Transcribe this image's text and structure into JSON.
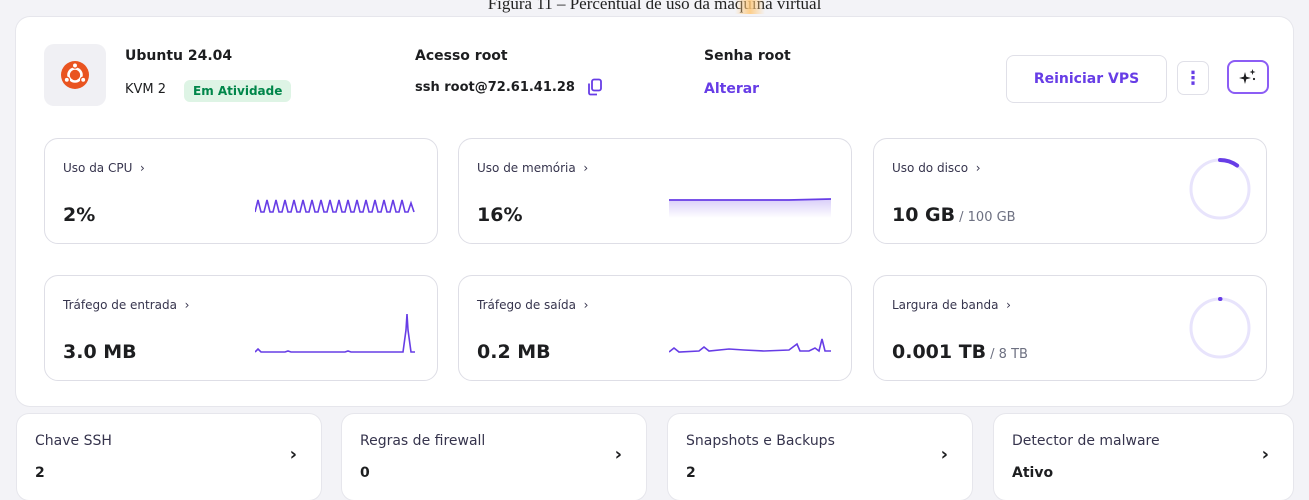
{
  "caption": {
    "text": "Figura 11 – Percentual de uso da máquina virtual"
  },
  "server": {
    "os": "Ubuntu 24.04",
    "plan": "KVM 2",
    "status": "Em Atividade"
  },
  "access": {
    "label": "Acesso root",
    "command": "ssh root@72.61.41.28"
  },
  "password": {
    "label": "Senha root",
    "action": "Alterar"
  },
  "actions": {
    "restart": "Reiniciar VPS",
    "more": "⋮"
  },
  "metrics": [
    {
      "label": "Uso da CPU",
      "value": "2%",
      "total": ""
    },
    {
      "label": "Uso de memória",
      "value": "16%",
      "total": ""
    },
    {
      "label": "Uso do disco",
      "value": "10 GB",
      "total": "/ 100 GB",
      "progress": 0.1
    },
    {
      "label": "Tráfego de entrada",
      "value": "3.0 MB",
      "total": ""
    },
    {
      "label": "Tráfego de saída",
      "value": "0.2 MB",
      "total": ""
    },
    {
      "label": "Largura de banda",
      "value": "0.001 TB",
      "total": "/ 8 TB",
      "progress": 0.0001
    }
  ],
  "quick_links": [
    {
      "label": "Chave SSH",
      "value": "2"
    },
    {
      "label": "Regras de firewall",
      "value": "0"
    },
    {
      "label": "Snapshots e Backups",
      "value": "2"
    },
    {
      "label": "Detector de malware",
      "value": "Ativo"
    }
  ],
  "colors": {
    "accent": "#673de6",
    "status_bg": "#def4e5",
    "status_text": "#00864a",
    "ubuntu": "#e95420",
    "ring_track": "#e8e4fc"
  }
}
